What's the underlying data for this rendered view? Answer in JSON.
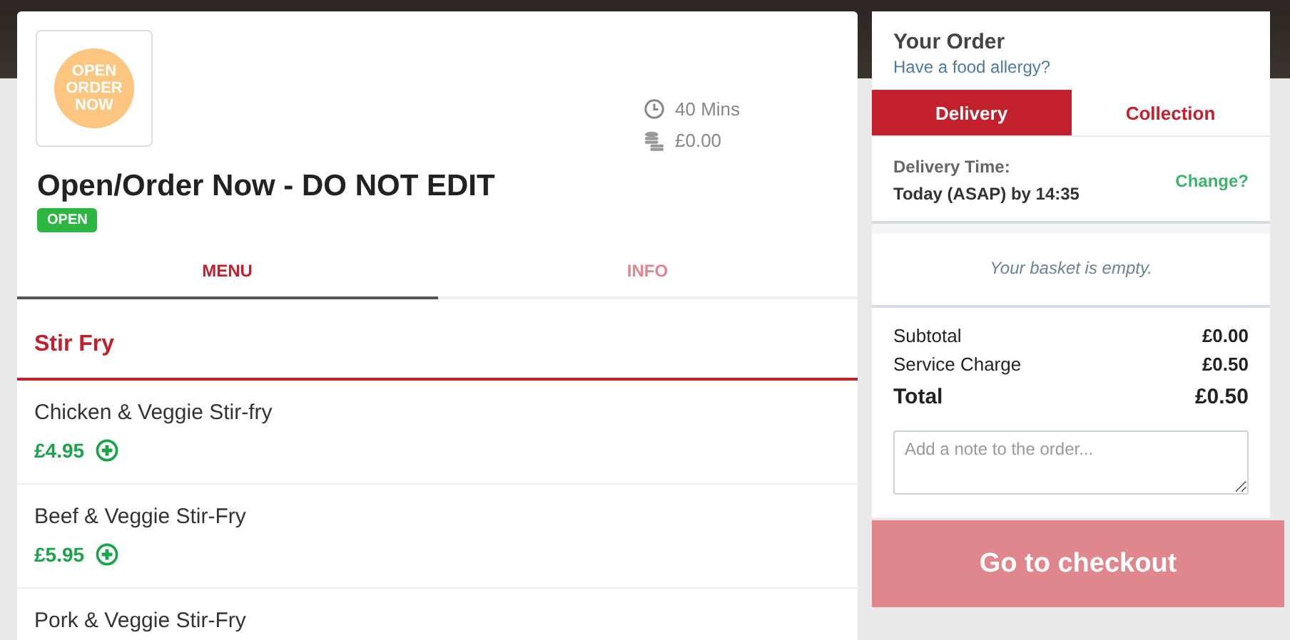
{
  "restaurant": {
    "logo_text": "OPEN ORDER NOW",
    "name": "Open/Order Now - DO NOT EDIT",
    "status": "OPEN",
    "delivery_time": "40 Mins",
    "delivery_fee": "£0.00"
  },
  "tabs": [
    {
      "label": "MENU",
      "selected": true
    },
    {
      "label": "INFO",
      "selected": false
    }
  ],
  "menu": {
    "category": "Stir Fry",
    "items": [
      {
        "name": "Chicken & Veggie Stir-fry",
        "price": "£4.95"
      },
      {
        "name": "Beef & Veggie Stir-Fry",
        "price": "£5.95"
      },
      {
        "name": "Pork & Veggie Stir-Fry"
      }
    ]
  },
  "order": {
    "title": "Your Order",
    "allergy_link": "Have a food allergy?",
    "modes": [
      {
        "label": "Delivery",
        "selected": true
      },
      {
        "label": "Collection",
        "selected": false
      }
    ],
    "time_label": "Delivery Time:",
    "time_value": "Today (ASAP) by 14:35",
    "change_link": "Change?",
    "empty_message": "Your basket is empty.",
    "totals": [
      {
        "label": "Subtotal",
        "value": "£0.00",
        "kind": "line"
      },
      {
        "label": "Service Charge",
        "value": "£0.50",
        "kind": "line"
      },
      {
        "label": "Total",
        "value": "£0.50",
        "kind": "total"
      }
    ],
    "note": {
      "placeholder": "Add a note to the order..."
    },
    "checkout": "Go to checkout"
  }
}
